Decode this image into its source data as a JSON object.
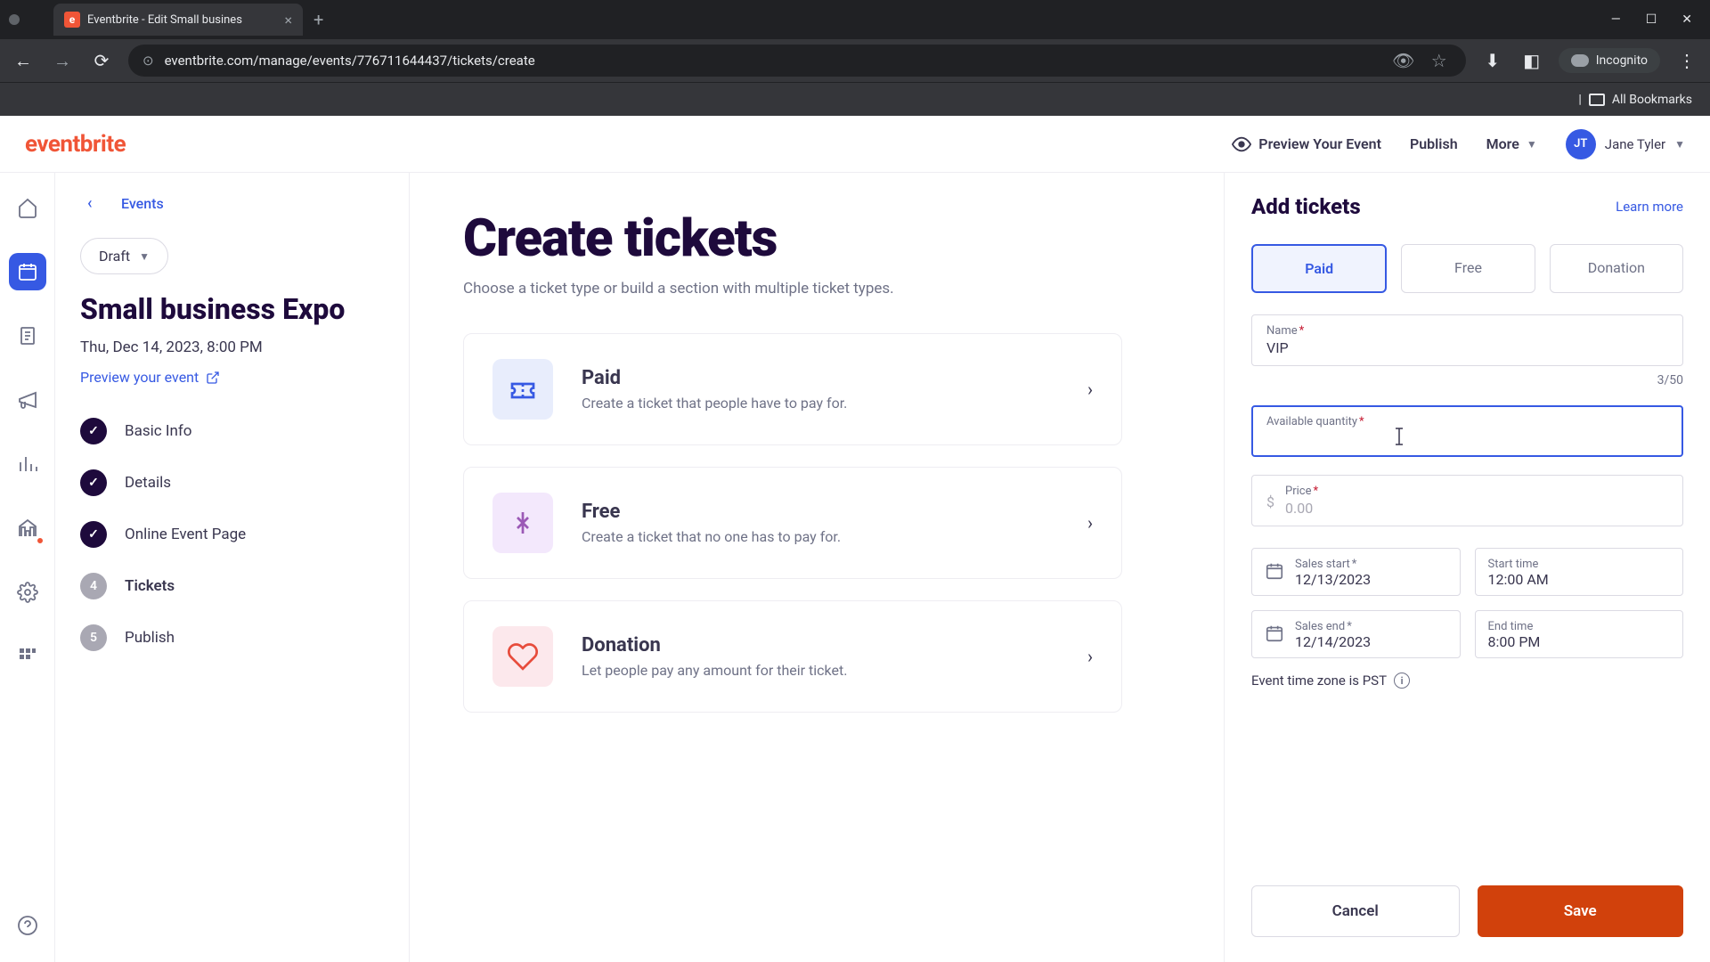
{
  "browser": {
    "tab_title": "Eventbrite - Edit Small busines",
    "url": "eventbrite.com/manage/events/776711644437/tickets/create",
    "incognito_label": "Incognito",
    "all_bookmarks": "All Bookmarks"
  },
  "header": {
    "logo": "eventbrite",
    "preview_event": "Preview Your Event",
    "publish": "Publish",
    "more": "More",
    "user_initials": "JT",
    "user_name": "Jane Tyler"
  },
  "sidebar": {
    "back_label": "Events",
    "draft_label": "Draft",
    "event_title": "Small business Expo",
    "event_date": "Thu, Dec 14, 2023, 8:00 PM",
    "preview_link": "Preview your event",
    "steps": [
      {
        "label": "Basic Info",
        "done": true
      },
      {
        "label": "Details",
        "done": true
      },
      {
        "label": "Online Event Page",
        "done": true
      },
      {
        "label": "Tickets",
        "done": false,
        "num": "4",
        "active": true
      },
      {
        "label": "Publish",
        "done": false,
        "num": "5"
      }
    ]
  },
  "main": {
    "title": "Create tickets",
    "subtitle": "Choose a ticket type or build a section with multiple ticket types.",
    "cards": [
      {
        "name": "Paid",
        "desc": "Create a ticket that people have to pay for."
      },
      {
        "name": "Free",
        "desc": "Create a ticket that no one has to pay for."
      },
      {
        "name": "Donation",
        "desc": "Let people pay any amount for their ticket."
      }
    ]
  },
  "panel": {
    "title": "Add tickets",
    "learn_more": "Learn more",
    "tabs": {
      "paid": "Paid",
      "free": "Free",
      "donation": "Donation"
    },
    "name_label": "Name",
    "name_value": "VIP",
    "name_count": "3/50",
    "qty_label": "Available quantity",
    "price_label": "Price",
    "price_currency": "$",
    "price_placeholder": "0.00",
    "sales_start_label": "Sales start",
    "sales_start_value": "12/13/2023",
    "start_time_label": "Start time",
    "start_time_value": "12:00 AM",
    "sales_end_label": "Sales end",
    "sales_end_value": "12/14/2023",
    "end_time_label": "End time",
    "end_time_value": "8:00 PM",
    "timezone_note": "Event time zone is PST",
    "cancel": "Cancel",
    "save": "Save"
  }
}
